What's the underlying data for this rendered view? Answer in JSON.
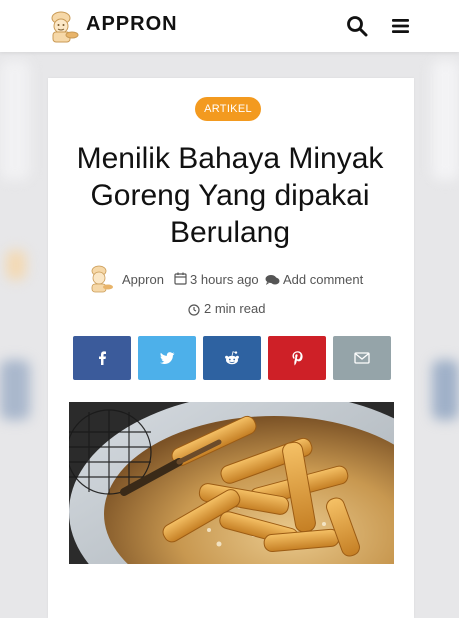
{
  "header": {
    "brand": "APPRON",
    "logo_icon": "chef-logo-icon",
    "search_icon": "search-icon",
    "menu_icon": "hamburger-menu-icon"
  },
  "article": {
    "category": "ARTIKEL",
    "title": "Menilik Bahaya Minyak Goreng Yang dipakai Berulang",
    "author": "Appron",
    "time_ago": "3 hours ago",
    "comment_label": "Add comment",
    "read_time": "2 min read"
  },
  "share": {
    "buttons": [
      {
        "name": "facebook",
        "icon": "facebook-icon",
        "color": "#3b5b9b"
      },
      {
        "name": "twitter",
        "icon": "twitter-icon",
        "color": "#4db0ea"
      },
      {
        "name": "reddit",
        "icon": "reddit-icon",
        "color": "#2e62a1"
      },
      {
        "name": "pinterest",
        "icon": "pinterest-icon",
        "color": "#ce2027"
      },
      {
        "name": "email",
        "icon": "email-icon",
        "color": "#95a4a9"
      }
    ]
  },
  "colors": {
    "badge": "#f39a1f",
    "text": "#111111",
    "meta": "#555555"
  }
}
